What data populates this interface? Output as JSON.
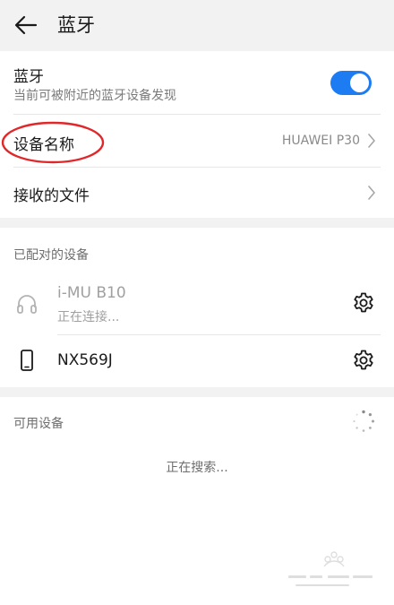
{
  "header": {
    "title": "蓝牙",
    "back_icon": "arrow-left-icon"
  },
  "bluetooth": {
    "label": "蓝牙",
    "sublabel": "当前可被附近的蓝牙设备发现",
    "enabled": true,
    "accent_color": "#1e7cf2"
  },
  "device_name": {
    "label": "设备名称",
    "value": "HUAWEI P30"
  },
  "received_files": {
    "label": "接收的文件"
  },
  "paired": {
    "section_label": "已配对的设备",
    "devices": [
      {
        "name": "i-MU B10",
        "status": "正在连接...",
        "icon": "headphones-icon"
      },
      {
        "name": "NX569J",
        "status": "",
        "icon": "phone-icon"
      }
    ]
  },
  "available": {
    "section_label": "可用设备",
    "searching_text": "正在搜索..."
  },
  "annotation": {
    "color": "#e0282b"
  }
}
